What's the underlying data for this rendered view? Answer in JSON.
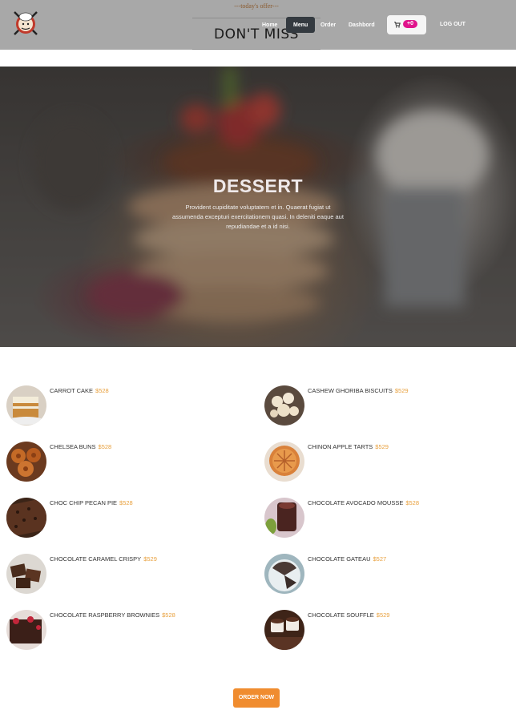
{
  "header": {
    "offer_small": "---today's offer---",
    "offer_big": "DON'T MISS",
    "nav": {
      "home": "Home",
      "menu": "Menu",
      "order": "Order",
      "dashboard": "Dashbord",
      "cart_count": "+0",
      "logout": "LOG OUT"
    }
  },
  "hero": {
    "title": "DESSERT",
    "text": "Provident cupiditate voluptatem et in. Quaerat fugiat ut assumenda excepturi exercitationem quasi. In deleniti eaque aut repudiandae et a id nisi."
  },
  "items": [
    {
      "name": "CARROT CAKE",
      "price": "$528"
    },
    {
      "name": "CASHEW GHORIBA BISCUITS",
      "price": "$529"
    },
    {
      "name": "CHELSEA BUNS",
      "price": "$528"
    },
    {
      "name": "CHINON APPLE TARTS",
      "price": "$529"
    },
    {
      "name": "CHOC CHIP PECAN PIE",
      "price": "$528"
    },
    {
      "name": "CHOCOLATE AVOCADO MOUSSE",
      "price": "$528"
    },
    {
      "name": "CHOCOLATE CARAMEL CRISPY",
      "price": "$529"
    },
    {
      "name": "CHOCOLATE GATEAU",
      "price": "$527"
    },
    {
      "name": "CHOCOLATE RASPBERRY BROWNIES",
      "price": "$528"
    },
    {
      "name": "CHOCOLATE SOUFFLE",
      "price": "$529"
    }
  ],
  "order_button": "ORDER NOW",
  "colors": {
    "header_bg": "#a8a8a8",
    "active_nav": "#343a40",
    "cart_badge": "#e0148c",
    "price": "#e8a03d",
    "order_button": "#f08c2f"
  }
}
